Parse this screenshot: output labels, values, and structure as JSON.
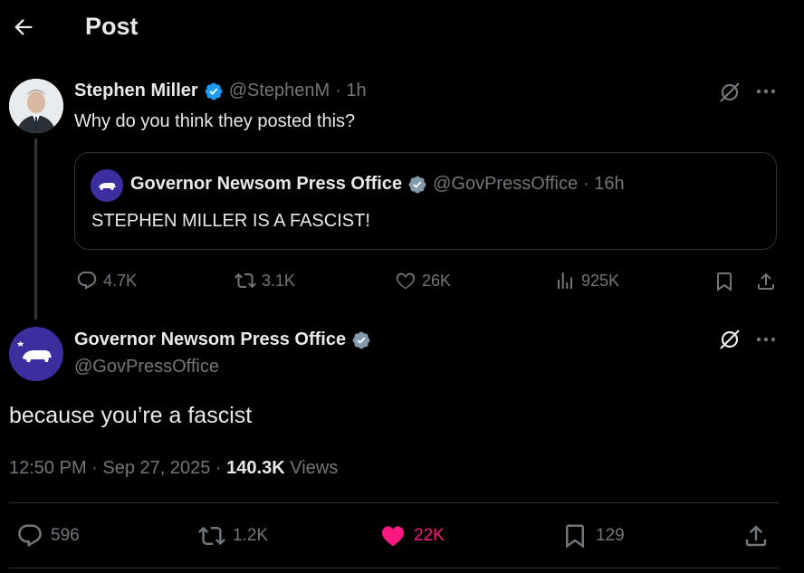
{
  "header": {
    "title": "Post"
  },
  "parent_post": {
    "author_name": "Stephen Miller",
    "handle": "@StephenM",
    "time": "· 1h",
    "text": "Why do you think they posted this?",
    "quote": {
      "author_name": "Governor Newsom Press Office",
      "handle": "@GovPressOffice",
      "time": "· 16h",
      "text": "STEPHEN MILLER IS A FASCIST!"
    },
    "stats": {
      "replies": "4.7K",
      "reposts": "3.1K",
      "likes": "26K",
      "views": "925K"
    }
  },
  "main_post": {
    "author_name": "Governor Newsom Press Office",
    "handle": "@GovPressOffice",
    "text": "because you’re a fascist",
    "timestamp": "12:50 PM · Sep 27, 2025 · ",
    "views_count": "140.3K",
    "views_label": " Views",
    "stats": {
      "replies": "596",
      "reposts": "1.2K",
      "likes": "22K",
      "bookmarks": "129"
    }
  },
  "colors": {
    "background": "#000000",
    "text": "#e7e9ea",
    "muted": "#71767b",
    "verified_blue": "#1d9bf0",
    "verified_gray": "#829aab",
    "like_pink": "#f91880",
    "gov_avatar": "#3b2e9e"
  },
  "icons": [
    "back-arrow-icon",
    "verified-badge-icon",
    "grok-icon",
    "more-icon",
    "reply-icon",
    "repost-icon",
    "like-icon",
    "views-icon",
    "bookmark-icon",
    "share-icon"
  ]
}
